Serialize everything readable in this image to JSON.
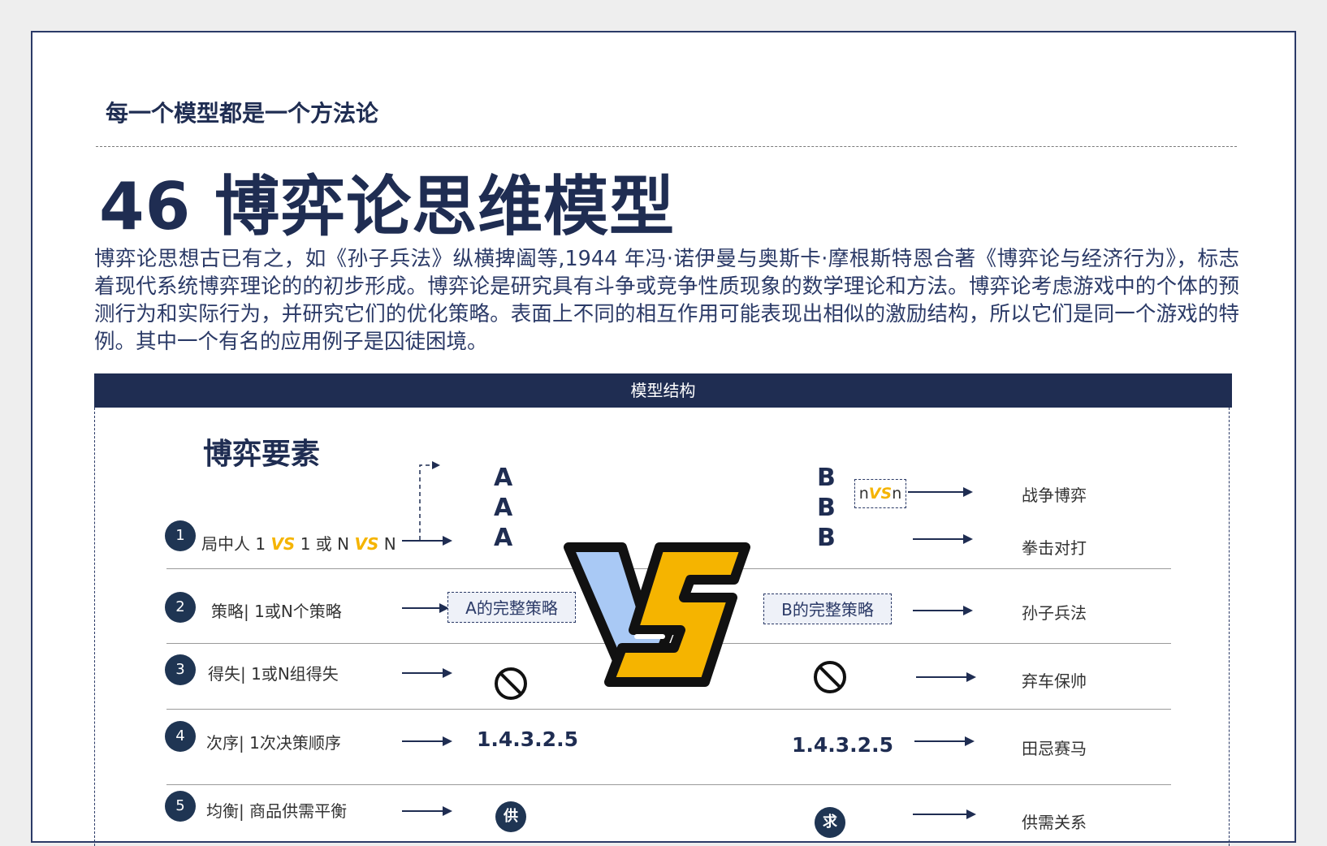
{
  "header": {
    "subtitle": "每一个模型都是一个方法论",
    "title": "46 博弈论思维模型"
  },
  "intro": "博弈论思想古已有之，如《孙子兵法》纵横捭阖等,1944 年冯·诺伊曼与奥斯卡·摩根斯特恩合著《博弈论与经济行为》，标志着现代系统博弈理论的的初步形成。博弈论是研究具有斗争或竞争性质现象的数学理论和方法。博弈论考虑游戏中的个体的预测行为和实际行为，并研究它们的优化策略。表面上不同的相互作用可能表现出相似的激励结构，所以它们是同一个游戏的特例。其中一个有名的应用例子是囚徒困境。",
  "banner": "模型结构",
  "section_title": "博弈要素",
  "vs_text": "VS",
  "rows": [
    {
      "num": "1",
      "label_a": "局中人 1 ",
      "vs1": "VS",
      "label_b": " 1  或 N ",
      "vs2": "VS",
      "label_c": " N"
    },
    {
      "num": "2",
      "label": "策略| 1或N个策略"
    },
    {
      "num": "3",
      "label": "得失| 1或N组得失"
    },
    {
      "num": "4",
      "label": "次序| 1次决策顺序"
    },
    {
      "num": "5",
      "label": "均衡| 商品供需平衡"
    }
  ],
  "side_a": {
    "letters": [
      "A",
      "A",
      "A"
    ],
    "strategy": "A的完整策略",
    "sequence": "1.4.3.2.5",
    "badge": "供"
  },
  "side_b": {
    "letters": [
      "B",
      "B",
      "B"
    ],
    "strategy": "B的完整策略",
    "sequence": "1.4.3.2.5",
    "badge": "求"
  },
  "nvsn": {
    "left": "n",
    "vs": "VS",
    "right": "n"
  },
  "examples": [
    "战争博弈",
    "拳击对打",
    "孙子兵法",
    "弃车保帅",
    "田忌赛马",
    "供需关系"
  ],
  "colors": {
    "navy": "#1f2d52",
    "accent": "#f5b400",
    "vs_blue": "#a9c9f5"
  },
  "icons": [
    "prohibited-icon",
    "vs-emblem"
  ]
}
